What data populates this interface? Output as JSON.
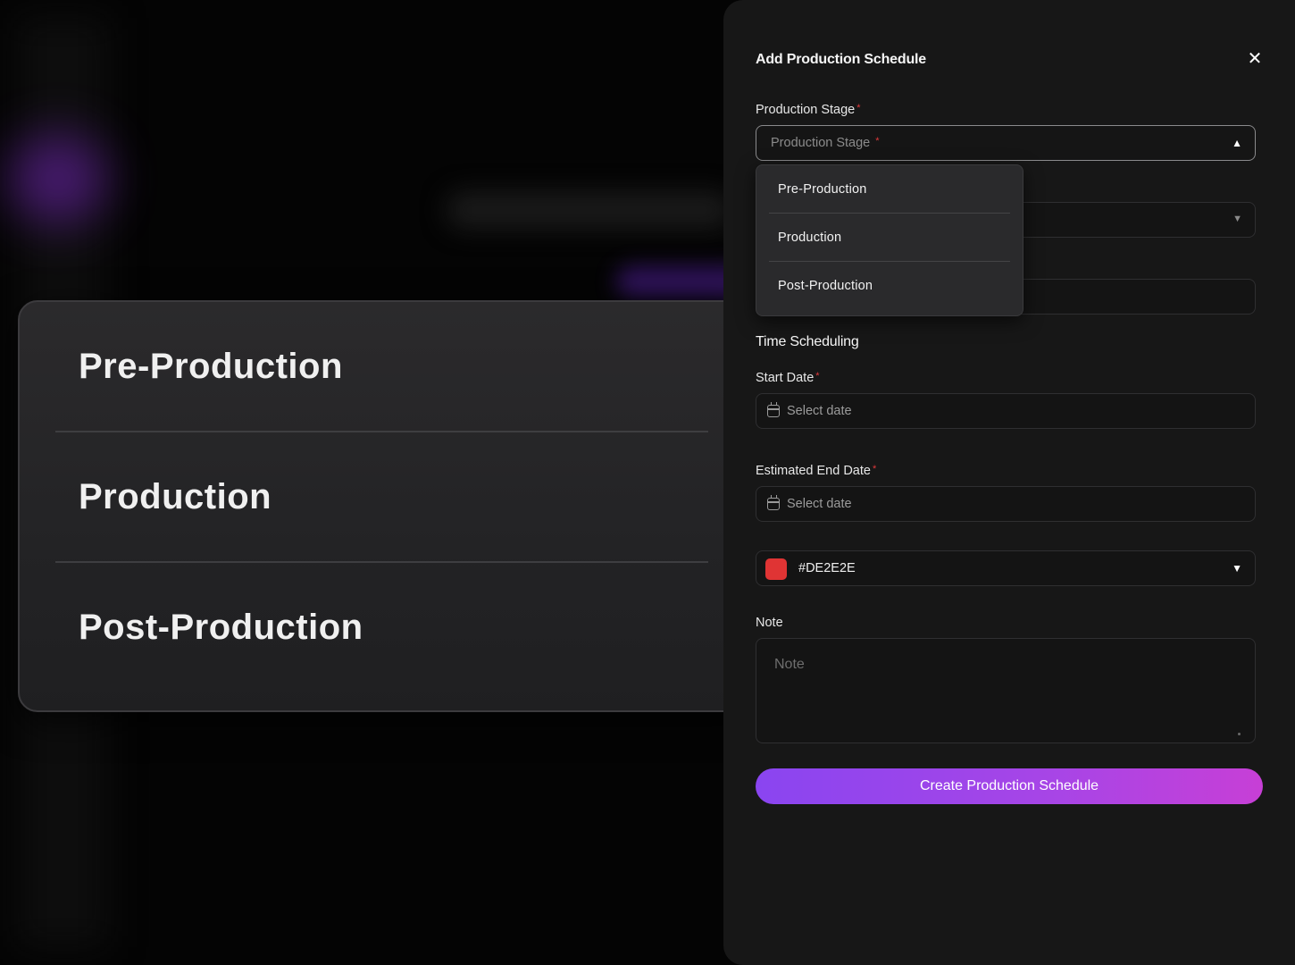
{
  "zoom_callout": {
    "items": [
      "Pre-Production",
      "Production",
      "Post-Production"
    ]
  },
  "panel": {
    "title": "Add Production Schedule",
    "close_icon": "close-icon",
    "production_stage": {
      "label": "Production Stage",
      "placeholder": "Production Stage",
      "required_mark": "*",
      "options": [
        "Pre-Production",
        "Production",
        "Post-Production"
      ]
    },
    "time_scheduling": {
      "title": "Time Scheduling",
      "start_date": {
        "label": "Start Date",
        "required_mark": "*",
        "placeholder": "Select date"
      },
      "end_date": {
        "label": "Estimated End Date",
        "required_mark": "*",
        "placeholder": "Select date"
      }
    },
    "color": {
      "value": "#DE2E2E",
      "swatch_color": "#e03434"
    },
    "note": {
      "label": "Note",
      "placeholder": "Note"
    },
    "submit_label": "Create Production Schedule"
  },
  "colors": {
    "accent_start": "#8a45f0",
    "accent_end": "#c73fd6",
    "panel_bg": "#171717",
    "required": "#e0393b"
  }
}
